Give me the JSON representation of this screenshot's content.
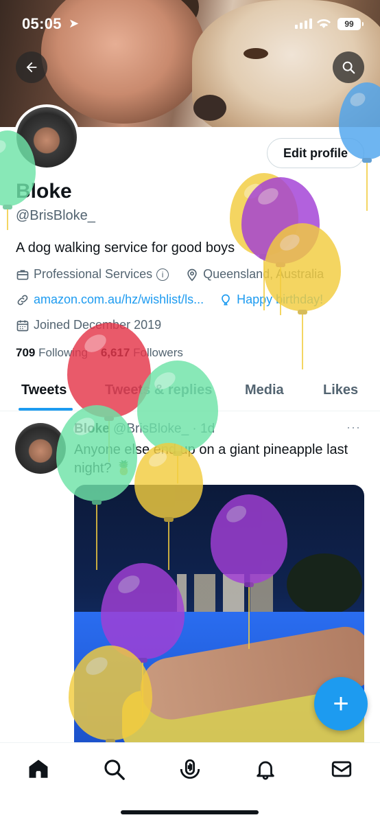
{
  "status_bar": {
    "time": "05:05",
    "battery": "99"
  },
  "profile": {
    "name": "Bloke",
    "handle": "@BrisBloke_",
    "edit_profile_label": "Edit profile",
    "bio": "A dog walking service for good boys",
    "category": "Professional Services",
    "location": "Queensland, Australia",
    "website": "amazon.com.au/hz/wishlist/ls...",
    "birthday": "Happy birthday!",
    "joined": "Joined December 2019",
    "following_count": "709",
    "following_label": "Following",
    "followers_count": "6,617",
    "followers_label": "Followers"
  },
  "tabs": [
    {
      "label": "Tweets",
      "active": true
    },
    {
      "label": "Tweets & replies",
      "active": false
    },
    {
      "label": "Media",
      "active": false
    },
    {
      "label": "Likes",
      "active": false
    }
  ],
  "tweet": {
    "author_name": "Bloke",
    "author_handle": "@BrisBloke_",
    "time_ago": "1d",
    "more": "···",
    "text": "Anyone else end up on a giant pineapple last night? 🍍"
  },
  "fab": {
    "label": "+"
  },
  "bottom_nav": [
    {
      "icon": "home-icon"
    },
    {
      "icon": "search-icon"
    },
    {
      "icon": "spaces-icon"
    },
    {
      "icon": "bell-icon"
    },
    {
      "icon": "mail-icon"
    }
  ],
  "colors": {
    "accent": "#1d9bf0",
    "text": "#0f1419",
    "secondary_text": "#536471",
    "balloon_green": "#6fe3a8",
    "balloon_purple": "#a23fd6",
    "balloon_yellow": "#f2cc3f",
    "balloon_red": "#e5364a",
    "balloon_blue": "#4fa5ee"
  }
}
